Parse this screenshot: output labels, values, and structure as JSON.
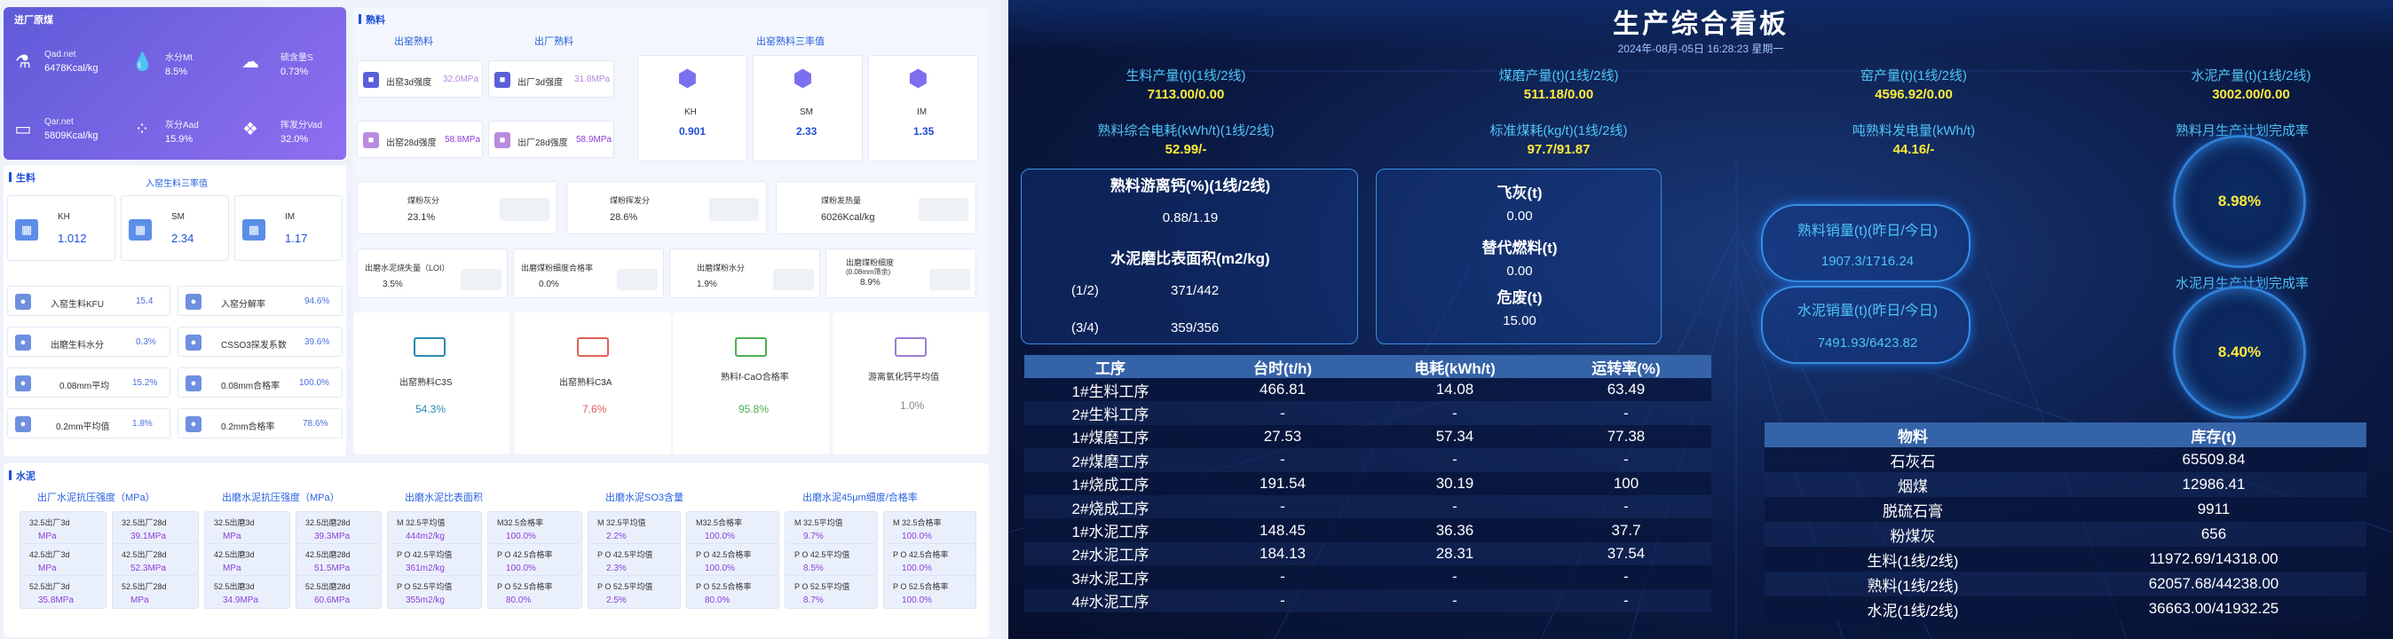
{
  "left": {
    "incoming": {
      "title": "进厂原煤",
      "items": [
        {
          "k": "Qad.net",
          "v": "6478Kcal/kg"
        },
        {
          "k": "水分Mt",
          "v": "8.5%"
        },
        {
          "k": "硫含量S",
          "v": "0.73%"
        },
        {
          "k": "Qar.net",
          "v": "5809Kcal/kg"
        },
        {
          "k": "灰分Aad",
          "v": "15.9%"
        },
        {
          "k": "挥发分Vad",
          "v": "32.0%"
        }
      ]
    },
    "raw": {
      "title": "生料",
      "subtitle": "入窑生料三率值",
      "items": [
        {
          "k": "KH",
          "v": "1.012"
        },
        {
          "k": "SM",
          "v": "2.34"
        },
        {
          "k": "IM",
          "v": "1.17"
        }
      ],
      "rows": [
        {
          "k": "入窑生料KFU",
          "v": "15.4"
        },
        {
          "k": "入窑分解率",
          "v": "94.6%"
        },
        {
          "k": "出磨生料水分",
          "v": "0.3%"
        },
        {
          "k": "CSSO3探发系数",
          "v": "39.6%"
        },
        {
          "k": "0.08mm平均",
          "v": "15.2%"
        },
        {
          "k": "0.08mm合格率",
          "v": "100.0%"
        },
        {
          "k": "0.2mm平均值",
          "v": "1.8%"
        },
        {
          "k": "0.2mm合格率",
          "v": "78.6%"
        }
      ]
    },
    "clinker": {
      "title": "熟料",
      "h1": "出窑熟料",
      "h2": "出厂熟料",
      "h3": "出窑熟料三率值",
      "items": [
        {
          "k": "出窑3d强度",
          "v": "32.0MPa"
        },
        {
          "k": "出厂3d强度",
          "v": "31.8MPa"
        },
        {
          "k": "出窑28d强度",
          "v": "58.8MPa"
        },
        {
          "k": "出厂28d强度",
          "v": "58.9MPa"
        }
      ],
      "ratios": [
        {
          "k": "KH",
          "v": "0.901"
        },
        {
          "k": "SM",
          "v": "2.33"
        },
        {
          "k": "IM",
          "v": "1.35"
        }
      ],
      "coal": [
        {
          "k": "煤粉灰分",
          "v": "23.1%"
        },
        {
          "k": "煤粉挥发分",
          "v": "28.6%"
        },
        {
          "k": "煤粉发热量",
          "v": "6026Kcal/kg"
        }
      ],
      "mill": [
        {
          "k": "出磨水泥烧失量（LOI）",
          "v": "3.5%"
        },
        {
          "k": "出磨煤粉细度合格率",
          "v": "0.0%"
        },
        {
          "k": "出磨煤粉水分",
          "v": "1.9%"
        },
        {
          "k": "出磨煤粉细度",
          "k2": "(0.08mm筛余)",
          "v": "8.9%"
        }
      ],
      "bigs": [
        {
          "k": "出窑熟料C3S",
          "v": "54.3%",
          "c": "#2a8ab0"
        },
        {
          "k": "出窑熟料C3A",
          "v": "7.6%",
          "c": "#e0605a"
        },
        {
          "k": "熟料f-CaO合格率",
          "v": "95.8%",
          "c": "#4caf50"
        },
        {
          "k": "游离氧化钙平均值",
          "v": "1.0%",
          "c": "#888"
        }
      ]
    },
    "cement": {
      "title": "水泥",
      "groups": [
        {
          "h": "出厂水泥抗压强度（MPa）",
          "items": [
            {
              "k": "32.5出厂3d",
              "v": "MPa"
            },
            {
              "k": "32.5出厂28d",
              "v": "39.1MPa"
            },
            {
              "k": "42.5出厂3d",
              "v": "MPa"
            },
            {
              "k": "42.5出厂28d",
              "v": "52.3MPa"
            },
            {
              "k": "52.5出厂3d",
              "v": "35.8MPa"
            },
            {
              "k": "52.5出厂28d",
              "v": "MPa"
            }
          ]
        },
        {
          "h": "出磨水泥抗压强度（MPa）",
          "items": [
            {
              "k": "32.5出磨3d",
              "v": "MPa"
            },
            {
              "k": "32.5出磨28d",
              "v": "39.3MPa"
            },
            {
              "k": "42.5出磨3d",
              "v": "MPa"
            },
            {
              "k": "42.5出磨28d",
              "v": "51.5MPa"
            },
            {
              "k": "52.5出磨3d",
              "v": "34.9MPa"
            },
            {
              "k": "52.5出磨28d",
              "v": "60.6MPa"
            }
          ]
        },
        {
          "h": "出磨水泥比表面积",
          "items": [
            {
              "k": "M 32.5平均值",
              "v": "444m2/kg"
            },
            {
              "k": "M32.5合格率",
              "v": "100.0%"
            },
            {
              "k": "P O 42.5平均值",
              "v": "361m2/kg"
            },
            {
              "k": "P O 42.5合格率",
              "v": "100.0%"
            },
            {
              "k": "P O 52.5平均值",
              "v": "355m2/kg"
            },
            {
              "k": "P O 52.5合格率",
              "v": "80.0%"
            }
          ]
        },
        {
          "h": "出磨水泥SO3含量",
          "items": [
            {
              "k": "M 32.5平均值",
              "v": "2.2%"
            },
            {
              "k": "M32.5合格率",
              "v": "100.0%"
            },
            {
              "k": "P O 42.5平均值",
              "v": "2.3%"
            },
            {
              "k": "P O 42.5合格率",
              "v": "100.0%"
            },
            {
              "k": "P O 52.5平均值",
              "v": "2.5%"
            },
            {
              "k": "P O 52.5合格率",
              "v": "80.0%"
            }
          ]
        },
        {
          "h": "出磨水泥45μm细度/合格率",
          "items": [
            {
              "k": "M 32.5平均值",
              "v": "9.7%"
            },
            {
              "k": "M 32.5合格率",
              "v": "100.0%"
            },
            {
              "k": "P O 42.5平均值",
              "v": "8.5%"
            },
            {
              "k": "P O 42.5合格率",
              "v": "100.0%"
            },
            {
              "k": "P O 52.5平均值",
              "v": "8.7%"
            },
            {
              "k": "P O 52.5合格率",
              "v": "100.0%"
            }
          ]
        }
      ]
    }
  },
  "right": {
    "title": "生产综合看板",
    "date": "2024年-08月-05日 16:28:23 星期一",
    "kpis": [
      {
        "k": "生料产量(t)(1线/2线)",
        "v": "7113.00/0.00"
      },
      {
        "k": "煤磨产量(t)(1线/2线)",
        "v": "511.18/0.00"
      },
      {
        "k": "窑产量(t)(1线/2线)",
        "v": "4596.92/0.00"
      },
      {
        "k": "水泥产量(t)(1线/2线)",
        "v": "3002.00/0.00"
      },
      {
        "k": "熟料综合电耗(kWh/t)(1线/2线)",
        "v": "52.99/-"
      },
      {
        "k": "标准煤耗(kg/t)(1线/2线)",
        "v": "97.7/91.87"
      },
      {
        "k": "吨熟料发电量(kWh/t)",
        "v": "44.16/-"
      }
    ],
    "box1": {
      "t1": "熟料游离钙(%)(1线/2线)",
      "v1": "0.88/1.19",
      "t2": "水泥磨比表面积(m2/kg)",
      "r1k": "(1/2)",
      "r1v": "371/442",
      "r2k": "(3/4)",
      "r2v": "359/356"
    },
    "box2": {
      "t1": "飞灰(t)",
      "v1": "0.00",
      "t2": "替代燃料(t)",
      "v2": "0.00",
      "t3": "危废(t)",
      "v3": "15.00"
    },
    "plan1": {
      "k": "熟料月生产计划完成率",
      "v": "8.98%"
    },
    "plan2": {
      "k": "水泥月生产计划完成率",
      "v": "8.40%"
    },
    "sales1": {
      "k": "熟料销量(t)(昨日/今日)",
      "v": "1907.3/1716.24"
    },
    "sales2": {
      "k": "水泥销量(t)(昨日/今日)",
      "v": "7491.93/6423.82"
    },
    "proc": {
      "headers": [
        "工序",
        "台时(t/h)",
        "电耗(kWh/t)",
        "运转率(%)"
      ],
      "rows": [
        [
          "1#生料工序",
          "466.81",
          "14.08",
          "63.49"
        ],
        [
          "2#生料工序",
          "-",
          "-",
          "-"
        ],
        [
          "1#煤磨工序",
          "27.53",
          "57.34",
          "77.38"
        ],
        [
          "2#煤磨工序",
          "-",
          "-",
          "-"
        ],
        [
          "1#烧成工序",
          "191.54",
          "30.19",
          "100"
        ],
        [
          "2#烧成工序",
          "-",
          "-",
          "-"
        ],
        [
          "1#水泥工序",
          "148.45",
          "36.36",
          "37.7"
        ],
        [
          "2#水泥工序",
          "184.13",
          "28.31",
          "37.54"
        ],
        [
          "3#水泥工序",
          "-",
          "-",
          "-"
        ],
        [
          "4#水泥工序",
          "-",
          "-",
          "-"
        ]
      ]
    },
    "stock": {
      "headers": [
        "物料",
        "库存(t)"
      ],
      "rows": [
        [
          "石灰石",
          "65509.84"
        ],
        [
          "烟煤",
          "12986.41"
        ],
        [
          "脱硫石膏",
          "9911"
        ],
        [
          "粉煤灰",
          "656"
        ],
        [
          "生料(1线/2线)",
          "11972.69/14318.00"
        ],
        [
          "熟料(1线/2线)",
          "62057.68/44238.00"
        ],
        [
          "水泥(1线/2线)",
          "36663.00/41932.25"
        ]
      ]
    }
  }
}
